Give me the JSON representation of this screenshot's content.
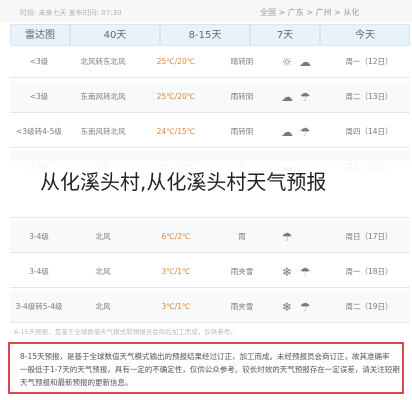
{
  "header": {
    "meta": "时段: 未来七天 发布时间: 07:30",
    "breadcrumb": "全国 > 广东 > 广州 > 从化"
  },
  "tabs": [
    "雷达图",
    "40天",
    "8-15天",
    "7天",
    "今天"
  ],
  "rows": [
    {
      "day": "周一（12日）",
      "desc": "晴转阴",
      "temp": "25℃/20℃",
      "wind": "北风转东北风",
      "level": "<3级",
      "icons": [
        "sun-icon",
        "cloud-icon"
      ]
    },
    {
      "day": "周二（13日）",
      "desc": "雨转阴",
      "temp": "25℃/20℃",
      "wind": "东南风转北风",
      "level": "<3级",
      "icons": [
        "cloud-icon",
        "rain-icon"
      ]
    },
    {
      "day": "周四（14日）",
      "desc": "雨转阴",
      "temp": "24℃/15℃",
      "wind": "东南风转北风",
      "level": "<3级转4-5级",
      "icons": [
        "cloud-icon",
        "rain-icon"
      ]
    },
    {
      "day": "周五（15日）",
      "desc": "阴",
      "temp": "16℃/10℃",
      "wind": "北风",
      "level": "3-4级",
      "icons": [
        "cloud-icon"
      ]
    },
    {
      "day": "",
      "desc": "",
      "temp": "",
      "wind": "",
      "level": "",
      "icons": []
    },
    {
      "day": "周日（17日）",
      "desc": "雨",
      "temp": "6℃/2℃",
      "wind": "北风",
      "level": "3-4级",
      "icons": [
        "rain-icon"
      ]
    },
    {
      "day": "周一（18日）",
      "desc": "雨夹雪",
      "temp": "3℃/1℃",
      "wind": "北风",
      "level": "3-4级",
      "icons": [
        "snow-icon",
        "rain-icon"
      ]
    },
    {
      "day": "周二（19日）",
      "desc": "雨夹雪",
      "temp": "3℃/1℃",
      "wind": "北风",
      "level": "3-4级转5-4级",
      "icons": [
        "snow-icon",
        "rain-icon"
      ]
    }
  ],
  "overlay_text": "从化溪头村,从化溪头村天气预报",
  "notice_bar": "8-15天预报，是基于全球数值天气模式和预报员会商后加工而成，仅供参考。",
  "notice": {
    "lines": [
      "8-15天预报，是基于全球数值天气模式输出的预报结果经过订正，加工而成。未经预报员会商订正，故其准确率",
      "一般低于1-7天的天气预报，具有一定的不确定性，仅供公众参考。较长时效的天气预报存在一定误差，请关注短期",
      "天气预报和最新预报的更新信息。"
    ]
  }
}
